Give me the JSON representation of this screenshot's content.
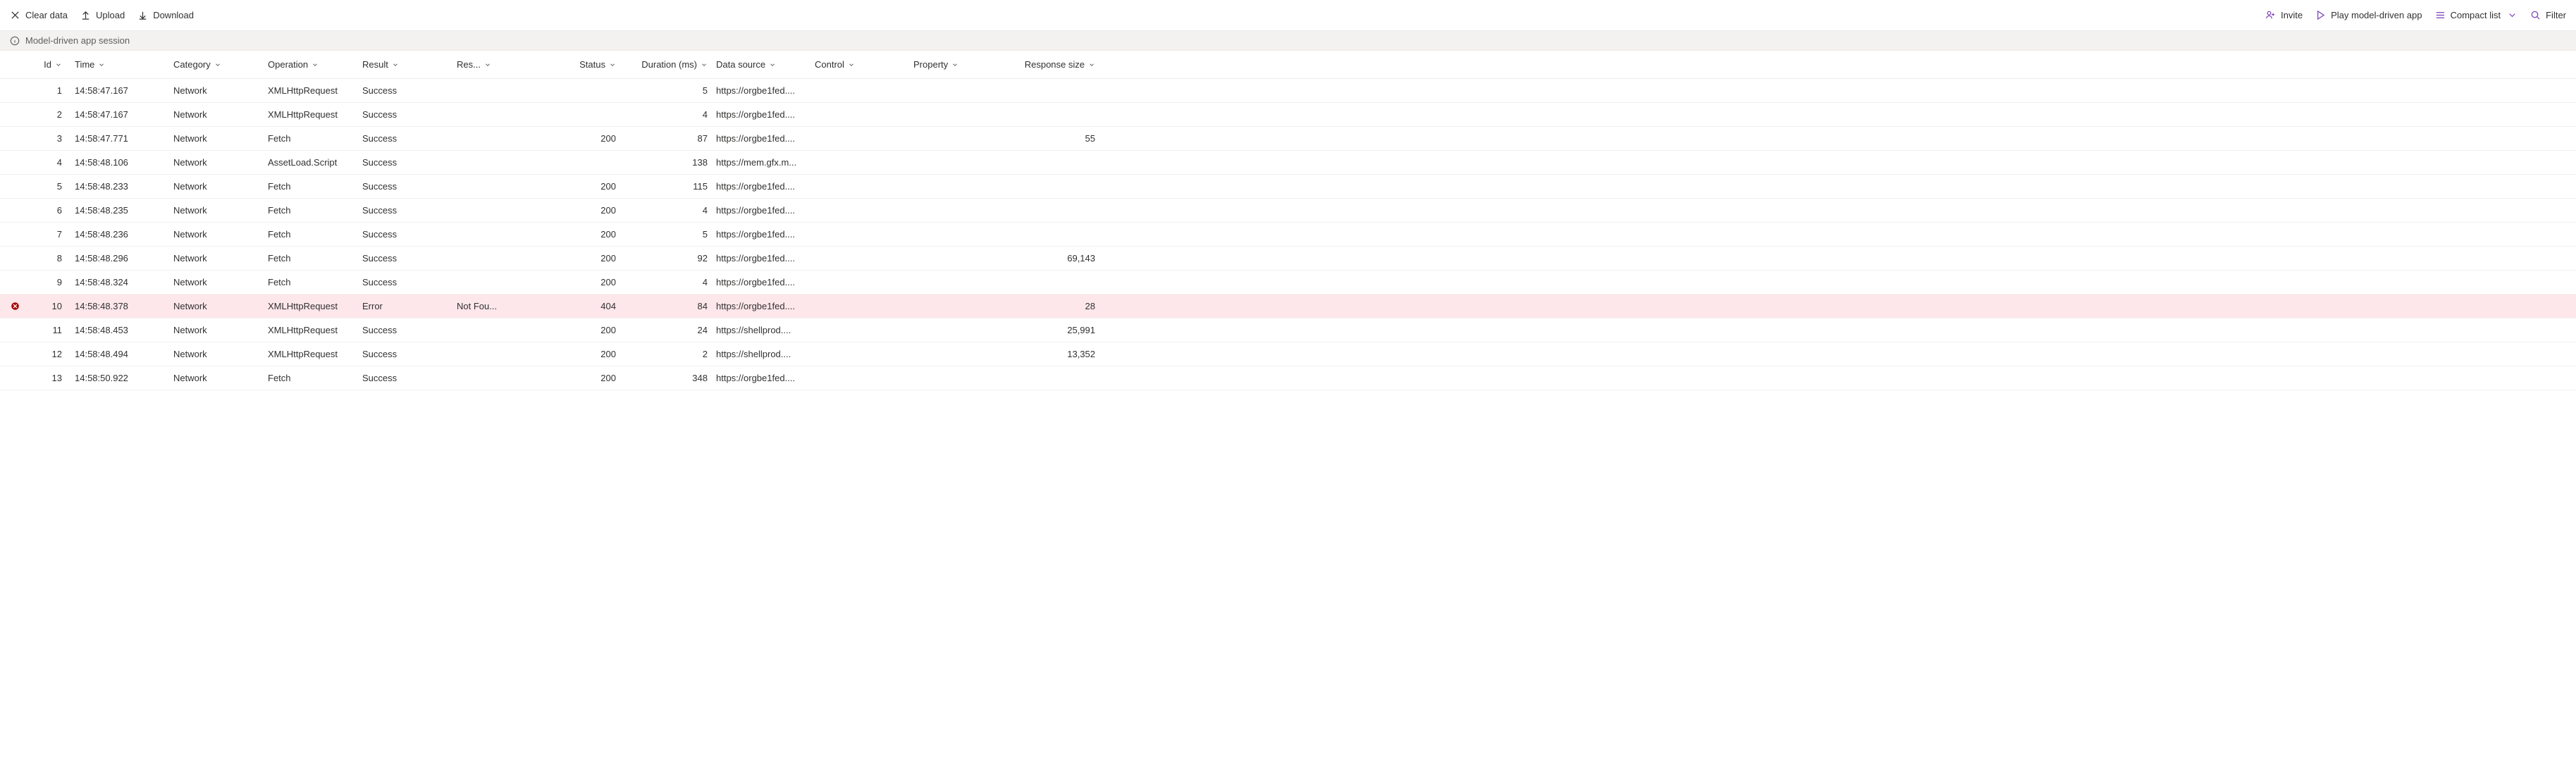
{
  "toolbar": {
    "clear_data": "Clear data",
    "upload": "Upload",
    "download": "Download",
    "invite": "Invite",
    "play_app": "Play model-driven app",
    "view_mode": "Compact list",
    "filter": "Filter"
  },
  "session_bar": {
    "label": "Model-driven app session"
  },
  "columns": [
    {
      "key": "icon",
      "label": ""
    },
    {
      "key": "id",
      "label": "Id"
    },
    {
      "key": "time",
      "label": "Time"
    },
    {
      "key": "category",
      "label": "Category"
    },
    {
      "key": "operation",
      "label": "Operation"
    },
    {
      "key": "result",
      "label": "Result"
    },
    {
      "key": "result_info",
      "label": "Res..."
    },
    {
      "key": "status",
      "label": "Status"
    },
    {
      "key": "duration",
      "label": "Duration (ms)"
    },
    {
      "key": "data_source",
      "label": "Data source"
    },
    {
      "key": "control",
      "label": "Control"
    },
    {
      "key": "property",
      "label": "Property"
    },
    {
      "key": "response_size",
      "label": "Response size"
    }
  ],
  "rows": [
    {
      "id": "1",
      "time": "14:58:47.167",
      "category": "Network",
      "operation": "XMLHttpRequest",
      "result": "Success",
      "result_info": "",
      "status": "",
      "duration": "5",
      "data_source": "https://orgbe1fed....",
      "control": "",
      "property": "",
      "response_size": "",
      "error": false
    },
    {
      "id": "2",
      "time": "14:58:47.167",
      "category": "Network",
      "operation": "XMLHttpRequest",
      "result": "Success",
      "result_info": "",
      "status": "",
      "duration": "4",
      "data_source": "https://orgbe1fed....",
      "control": "",
      "property": "",
      "response_size": "",
      "error": false
    },
    {
      "id": "3",
      "time": "14:58:47.771",
      "category": "Network",
      "operation": "Fetch",
      "result": "Success",
      "result_info": "",
      "status": "200",
      "duration": "87",
      "data_source": "https://orgbe1fed....",
      "control": "",
      "property": "",
      "response_size": "55",
      "error": false
    },
    {
      "id": "4",
      "time": "14:58:48.106",
      "category": "Network",
      "operation": "AssetLoad.Script",
      "result": "Success",
      "result_info": "",
      "status": "",
      "duration": "138",
      "data_source": "https://mem.gfx.m...",
      "control": "",
      "property": "",
      "response_size": "",
      "error": false
    },
    {
      "id": "5",
      "time": "14:58:48.233",
      "category": "Network",
      "operation": "Fetch",
      "result": "Success",
      "result_info": "",
      "status": "200",
      "duration": "115",
      "data_source": "https://orgbe1fed....",
      "control": "",
      "property": "",
      "response_size": "",
      "error": false
    },
    {
      "id": "6",
      "time": "14:58:48.235",
      "category": "Network",
      "operation": "Fetch",
      "result": "Success",
      "result_info": "",
      "status": "200",
      "duration": "4",
      "data_source": "https://orgbe1fed....",
      "control": "",
      "property": "",
      "response_size": "",
      "error": false
    },
    {
      "id": "7",
      "time": "14:58:48.236",
      "category": "Network",
      "operation": "Fetch",
      "result": "Success",
      "result_info": "",
      "status": "200",
      "duration": "5",
      "data_source": "https://orgbe1fed....",
      "control": "",
      "property": "",
      "response_size": "",
      "error": false
    },
    {
      "id": "8",
      "time": "14:58:48.296",
      "category": "Network",
      "operation": "Fetch",
      "result": "Success",
      "result_info": "",
      "status": "200",
      "duration": "92",
      "data_source": "https://orgbe1fed....",
      "control": "",
      "property": "",
      "response_size": "69,143",
      "error": false
    },
    {
      "id": "9",
      "time": "14:58:48.324",
      "category": "Network",
      "operation": "Fetch",
      "result": "Success",
      "result_info": "",
      "status": "200",
      "duration": "4",
      "data_source": "https://orgbe1fed....",
      "control": "",
      "property": "",
      "response_size": "",
      "error": false
    },
    {
      "id": "10",
      "time": "14:58:48.378",
      "category": "Network",
      "operation": "XMLHttpRequest",
      "result": "Error",
      "result_info": "Not Fou...",
      "status": "404",
      "duration": "84",
      "data_source": "https://orgbe1fed....",
      "control": "",
      "property": "",
      "response_size": "28",
      "error": true
    },
    {
      "id": "11",
      "time": "14:58:48.453",
      "category": "Network",
      "operation": "XMLHttpRequest",
      "result": "Success",
      "result_info": "",
      "status": "200",
      "duration": "24",
      "data_source": "https://shellprod....",
      "control": "",
      "property": "",
      "response_size": "25,991",
      "error": false
    },
    {
      "id": "12",
      "time": "14:58:48.494",
      "category": "Network",
      "operation": "XMLHttpRequest",
      "result": "Success",
      "result_info": "",
      "status": "200",
      "duration": "2",
      "data_source": "https://shellprod....",
      "control": "",
      "property": "",
      "response_size": "13,352",
      "error": false
    },
    {
      "id": "13",
      "time": "14:58:50.922",
      "category": "Network",
      "operation": "Fetch",
      "result": "Success",
      "result_info": "",
      "status": "200",
      "duration": "348",
      "data_source": "https://orgbe1fed....",
      "control": "",
      "property": "",
      "response_size": "",
      "error": false
    }
  ]
}
